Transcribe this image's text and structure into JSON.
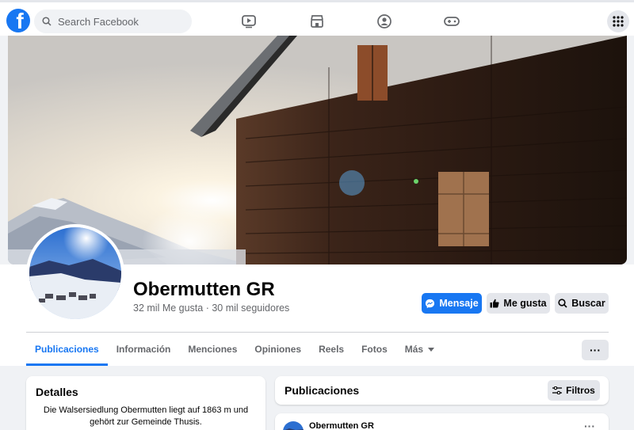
{
  "topbar": {
    "logo_letter": "f",
    "search_placeholder": "Search Facebook",
    "nav_icons": [
      "video-icon",
      "marketplace-icon",
      "groups-icon",
      "gaming-icon"
    ],
    "menu_icon": "grid-menu-icon"
  },
  "page": {
    "name": "Obermutten GR",
    "stats": "32 mil Me gusta · 30 mil seguidores"
  },
  "actions": {
    "message": "Mensaje",
    "like": "Me gusta",
    "search": "Buscar"
  },
  "tabs": [
    {
      "label": "Publicaciones",
      "active": true
    },
    {
      "label": "Información"
    },
    {
      "label": "Menciones"
    },
    {
      "label": "Opiniones"
    },
    {
      "label": "Reels"
    },
    {
      "label": "Fotos"
    },
    {
      "label": "Más"
    }
  ],
  "tabs_more_button": "···",
  "details": {
    "title": "Detalles",
    "text": "Die Walsersiedlung Obermutten liegt auf 1863 m und gehört zur Gemeinde Thusis."
  },
  "publications": {
    "title": "Publicaciones",
    "filter": "Filtros"
  },
  "post": {
    "author": "Obermutten GR",
    "more": "···"
  },
  "colors": {
    "accent": "#1877f2",
    "background": "#f0f2f5",
    "button_gray": "#e4e6eb"
  }
}
